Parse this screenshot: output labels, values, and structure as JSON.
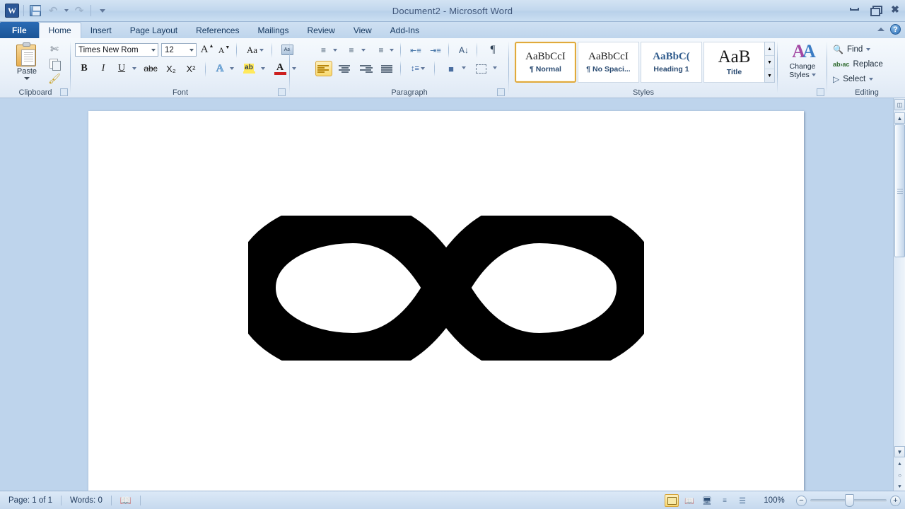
{
  "window": {
    "title": "Document2  -  Microsoft Word",
    "controls": {
      "minimize": "minimize-button",
      "restore": "restore-button",
      "close": "✕"
    }
  },
  "qat": {
    "app_logo": "W",
    "items": [
      {
        "name": "save-button",
        "label": "Save"
      },
      {
        "name": "undo-button",
        "label": "Undo",
        "glyph": "↺"
      },
      {
        "name": "redo-button",
        "label": "Redo",
        "glyph": "↻"
      },
      {
        "name": "customize-qat-button",
        "label": "Customize Quick Access Toolbar"
      }
    ]
  },
  "tabs": [
    {
      "label": "File",
      "active": false,
      "kind": "file"
    },
    {
      "label": "Home",
      "active": true
    },
    {
      "label": "Insert",
      "active": false
    },
    {
      "label": "Page Layout",
      "active": false
    },
    {
      "label": "References",
      "active": false
    },
    {
      "label": "Mailings",
      "active": false
    },
    {
      "label": "Review",
      "active": false
    },
    {
      "label": "View",
      "active": false
    },
    {
      "label": "Add-Ins",
      "active": false
    }
  ],
  "ribbon": {
    "help_label": "?",
    "groups": {
      "clipboard": {
        "label": "Clipboard",
        "paste_label": "Paste",
        "cut_label": "Cut",
        "copy_label": "Copy",
        "format_painter_label": "Format Painter"
      },
      "font": {
        "label": "Font",
        "font_name": "Times New Rom",
        "font_size": "12",
        "grow_font": "A",
        "shrink_font": "A",
        "change_case": "Aa",
        "clear_formatting": "Clear Formatting",
        "bold": "B",
        "italic": "I",
        "underline": "U",
        "strikethrough": "abc",
        "subscript": "X₂",
        "superscript": "X²",
        "text_effects": "A",
        "highlight": "ab",
        "font_color": "A"
      },
      "paragraph": {
        "label": "Paragraph",
        "bullets": "Bullets",
        "numbering": "Numbering",
        "multilevel": "Multilevel List",
        "decrease_indent": "Decrease Indent",
        "increase_indent": "Increase Indent",
        "sort": "Sort",
        "show_marks": "¶",
        "align_left": "Align Text Left",
        "align_center": "Center",
        "align_right": "Align Text Right",
        "justify": "Justify",
        "line_spacing": "Line and Paragraph Spacing",
        "shading": "Shading",
        "borders": "Borders",
        "active_alignment": "align_left"
      },
      "styles": {
        "label": "Styles",
        "items": [
          {
            "sample": "AaBbCcI",
            "name": "¶ Normal",
            "selected": true,
            "color": "#1a1a1a",
            "size": "15px"
          },
          {
            "sample": "AaBbCcI",
            "name": "¶ No Spaci...",
            "selected": false,
            "color": "#1a1a1a",
            "size": "15px"
          },
          {
            "sample": "AaBbC(",
            "name": "Heading 1",
            "selected": false,
            "color": "#2f5b8c",
            "size": "15px"
          },
          {
            "sample": "AaB",
            "name": "Title",
            "selected": false,
            "color": "#1a1a1a",
            "size": "24px"
          }
        ],
        "scroll_up": "▲",
        "scroll_down": "▼",
        "more": "▼"
      },
      "change_styles": {
        "label": "Change\nStyles",
        "line1": "Change",
        "line2": "Styles"
      },
      "editing": {
        "label": "Editing",
        "find": "Find",
        "replace": "Replace",
        "select": "Select"
      }
    }
  },
  "document": {
    "content_symbol": "∞",
    "content_color": "#000000"
  },
  "scrollbar": {
    "ruler_toggle": "ruler-toggle",
    "up_arrow": "▲",
    "down_arrow": "▼",
    "prev_page": "⯅",
    "select_browse_object": "○",
    "next_page": "⯆"
  },
  "statusbar": {
    "page": "Page: 1 of 1",
    "words": "Words: 0",
    "proofing": "proofing-errors-icon",
    "zoom_level": "100%",
    "zoom_out": "−",
    "zoom_in": "+",
    "views": [
      {
        "name": "print-layout-view",
        "active": true
      },
      {
        "name": "full-screen-reading-view",
        "active": false
      },
      {
        "name": "web-layout-view",
        "active": false
      },
      {
        "name": "outline-view",
        "active": false
      },
      {
        "name": "draft-view",
        "active": false
      }
    ]
  }
}
